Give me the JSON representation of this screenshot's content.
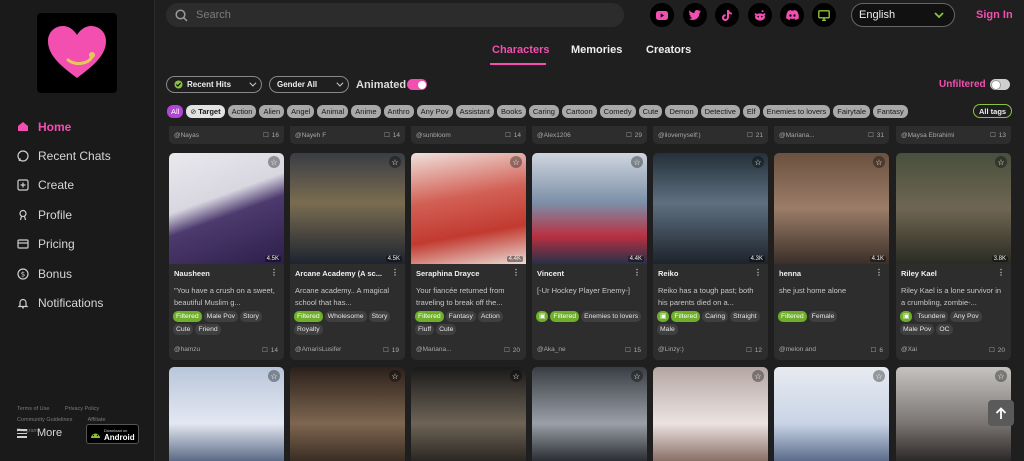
{
  "search": {
    "placeholder": "Search"
  },
  "social": [
    "youtube-icon",
    "twitter-icon",
    "tiktok-icon",
    "reddit-icon",
    "discord-icon",
    "monitor-icon"
  ],
  "language": "English",
  "signin_label": "Sign In",
  "sidebar": {
    "items": [
      {
        "label": "Home",
        "icon": "home-icon",
        "active": true
      },
      {
        "label": "Recent Chats",
        "icon": "chat-icon"
      },
      {
        "label": "Create",
        "icon": "plus-square-icon"
      },
      {
        "label": "Profile",
        "icon": "profile-icon"
      },
      {
        "label": "Pricing",
        "icon": "card-icon"
      },
      {
        "label": "Bonus",
        "icon": "dollar-icon"
      },
      {
        "label": "Notifications",
        "icon": "bell-icon"
      }
    ],
    "legal": [
      "Terms of Use",
      "Privacy Policy",
      "Community Guidelines",
      "Affiliate Program"
    ],
    "more_label": "More",
    "android_small": "Download on",
    "android_big": "Android"
  },
  "tabs": [
    "Characters",
    "Memories",
    "Creators"
  ],
  "filters": {
    "sort": "Recent Hits",
    "gender": "Gender All",
    "animated_label": "Animated",
    "unfiltered_label": "Unfiltered"
  },
  "tags": [
    "All",
    "Target",
    "Action",
    "Alien",
    "Angel",
    "Animal",
    "Anime",
    "Anthro",
    "Any Pov",
    "Assistant",
    "Books",
    "Caring",
    "Cartoon",
    "Comedy",
    "Cute",
    "Demon",
    "Detective",
    "Elf",
    "Enemies to lovers",
    "Fairytale",
    "Fantasy"
  ],
  "all_tags_label": "All tags",
  "colors": {
    "accent": "#f24fb1",
    "green": "#6fae2b",
    "purple": "#b146d6"
  },
  "prev_row": [
    {
      "author": "@Nayas",
      "count": "16"
    },
    {
      "author": "@Nayeh F",
      "count": "14"
    },
    {
      "author": "@sunbloom",
      "count": "14"
    },
    {
      "author": "@Alex1206",
      "count": "29"
    },
    {
      "author": "@ilovemyself:)",
      "count": "21"
    },
    {
      "author": "@Mariana...",
      "count": "31"
    },
    {
      "author": "@Maysa Ebrahimi",
      "count": "13"
    }
  ],
  "cards": [
    {
      "name": "Nausheen",
      "views": "4.5K",
      "desc": "\"You have a crush on a sweet, beautiful Muslim g...",
      "tags": [
        "Filtered",
        "Male Pov",
        "Story",
        "Cute",
        "Friend"
      ],
      "author": "@hamzu",
      "count": "14"
    },
    {
      "name": "Arcane Academy (A sc...",
      "views": "4.5K",
      "desc": "Arcane academy.. A magical school that has...",
      "tags": [
        "Filtered",
        "Wholesome",
        "Story",
        "Royalty"
      ],
      "author": "@AmarisLusifer",
      "count": "19"
    },
    {
      "name": "Seraphina Drayce",
      "views": "4.4K",
      "desc": "Your fiancée returned from traveling to break off the...",
      "tags": [
        "Filtered",
        "Fantasy",
        "Action",
        "Fluff",
        "Cute"
      ],
      "author": "@Mariana...",
      "count": "20"
    },
    {
      "name": "Vincent",
      "views": "4.4K",
      "desc": "[-Ur Hockey Player Enemy-]",
      "tags": [
        "img",
        "Filtered",
        "Enemies to lovers"
      ],
      "author": "@Aka_ne",
      "count": "15"
    },
    {
      "name": "Reiko",
      "views": "4.3K",
      "desc": "Reiko has a tough past; both his parents died on a...",
      "tags": [
        "img",
        "Filtered",
        "Caring",
        "Straight",
        "Male"
      ],
      "author": "@Linzy:)",
      "count": "12"
    },
    {
      "name": "henna",
      "views": "4.1K",
      "desc": "she just home alone",
      "tags": [
        "Filtered",
        "Female"
      ],
      "author": "@melon and",
      "count": "6"
    },
    {
      "name": "Riley Kael",
      "views": "3.8K",
      "desc": "Riley Kael is a lone survivor in a crumbling, zombie-...",
      "tags": [
        "img",
        "Tsundere",
        "Any Pov",
        "Male Pov",
        "OC"
      ],
      "author": "@Xai",
      "count": "20"
    }
  ]
}
